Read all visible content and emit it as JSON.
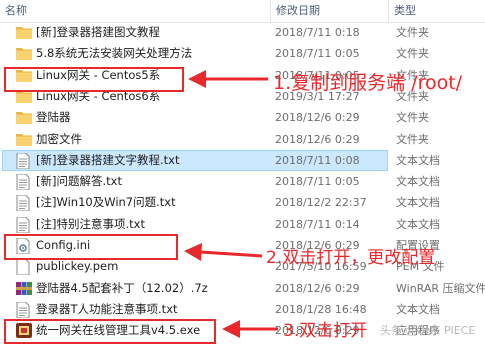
{
  "columns": {
    "name": "名称",
    "date": "修改日期",
    "type": "类型"
  },
  "rows": [
    {
      "name": "[新]登录器搭建图文教程",
      "date": "2018/7/11 0:18",
      "type": "文件夹",
      "icon": "folder-icon"
    },
    {
      "name": "5.8系统无法安装网关处理方法",
      "date": "2018/7/11 0:05",
      "type": "文件夹",
      "icon": "folder-icon"
    },
    {
      "name": "Linux网关 - Centos5系",
      "date": "2018/7/11 0:05",
      "type": "文件夹",
      "icon": "folder-icon"
    },
    {
      "name": "Linux网关 - Centos6系",
      "date": "2019/3/1 17:27",
      "type": "文件夹",
      "icon": "folder-icon"
    },
    {
      "name": "登陆器",
      "date": "2018/12/6 0:29",
      "type": "文件夹",
      "icon": "folder-icon"
    },
    {
      "name": "加密文件",
      "date": "2018/12/6 0:29",
      "type": "文件夹",
      "icon": "folder-icon"
    },
    {
      "name": "[新]登录器搭建文字教程.txt",
      "date": "2018/7/11 0:08",
      "type": "文本文档",
      "icon": "text-file-icon"
    },
    {
      "name": "[新]问题解答.txt",
      "date": "2018/7/11 0:05",
      "type": "文本文档",
      "icon": "text-file-icon"
    },
    {
      "name": "[注]Win10及Win7问题.txt",
      "date": "2018/12/2 22:37",
      "type": "文本文档",
      "icon": "text-file-icon"
    },
    {
      "name": "[注]特别注意事项.txt",
      "date": "2018/7/11 0:14",
      "type": "文本文档",
      "icon": "text-file-icon"
    },
    {
      "name": "Config.ini",
      "date": "2018/12/6 0:29",
      "type": "配置设置",
      "icon": "config-file-icon"
    },
    {
      "name": "publickey.pem",
      "date": "2017/5/10 16:59",
      "type": "PEM 文件",
      "icon": "pem-file-icon"
    },
    {
      "name": "登陆器4.5配套补丁（12.02）.7z",
      "date": "2018/12/6 0:29",
      "type": "WinRAR 压缩文件",
      "icon": "winrar-archive-icon"
    },
    {
      "name": "登录器T人功能注意事项.txt",
      "date": "2018/1/28 16:48",
      "type": "文本文档",
      "icon": "text-file-icon"
    },
    {
      "name": "统一网关在线管理工具v4.5.exe",
      "date": "2018/12/6 0:29",
      "type": "应用程序",
      "icon": "app-exe-icon"
    }
  ],
  "annotations": {
    "step1": "1.复制到服务端 /root/",
    "step2": "2.双击打开，更改配置",
    "step3": "3.双击打开"
  },
  "watermark": "头条 @ONE PIECE",
  "colors": {
    "annotation_red": "#e8292b",
    "selection": "#cce8ff",
    "folder": "#f5c55b",
    "header_text": "#4c607a"
  }
}
